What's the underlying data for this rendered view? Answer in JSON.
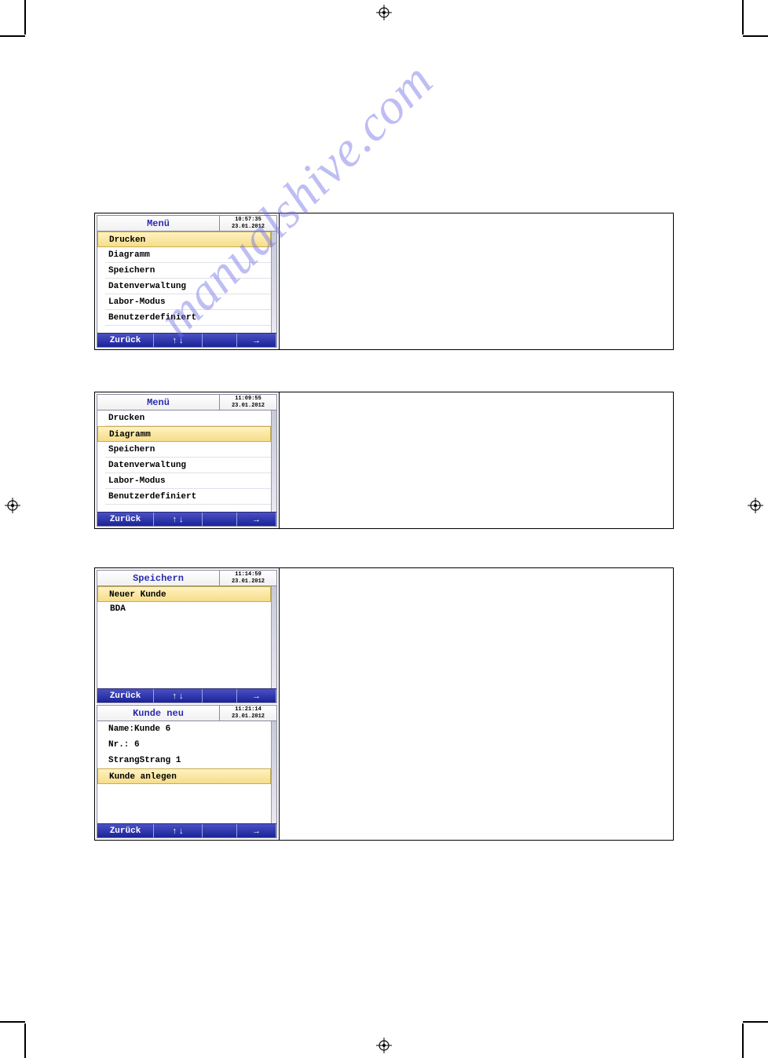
{
  "watermark": "manualshive.com",
  "screens": {
    "menu1": {
      "title": "Menü",
      "time": "10:57:35",
      "date": "23.01.2012",
      "items": [
        "Drucken",
        "Diagramm",
        "Speichern",
        "Datenverwaltung",
        "Labor-Modus",
        "Benutzerdefiniert"
      ],
      "selected": 0
    },
    "menu2": {
      "title": "Menü",
      "time": "11:09:55",
      "date": "23.01.2012",
      "items": [
        "Drucken",
        "Diagramm",
        "Speichern",
        "Datenverwaltung",
        "Labor-Modus",
        "Benutzerdefiniert"
      ],
      "selected": 1
    },
    "save": {
      "title": "Speichern",
      "time": "11:14:59",
      "date": "23.01.2012",
      "new_customer_label": "Neuer Kunde",
      "list_item": "BDA"
    },
    "newcust": {
      "title": "Kunde neu",
      "time": "11:21:14",
      "date": "23.01.2012",
      "rows": [
        {
          "label": "Name:",
          "value": "Kunde 6"
        },
        {
          "label": "Nr.:",
          "value": " 6"
        },
        {
          "label": "Strang",
          "value": "Strang 1"
        }
      ],
      "create_label": "Kunde anlegen"
    }
  },
  "footer": {
    "back": "Zurück",
    "updown": "↑ ↓",
    "enter": "→"
  }
}
